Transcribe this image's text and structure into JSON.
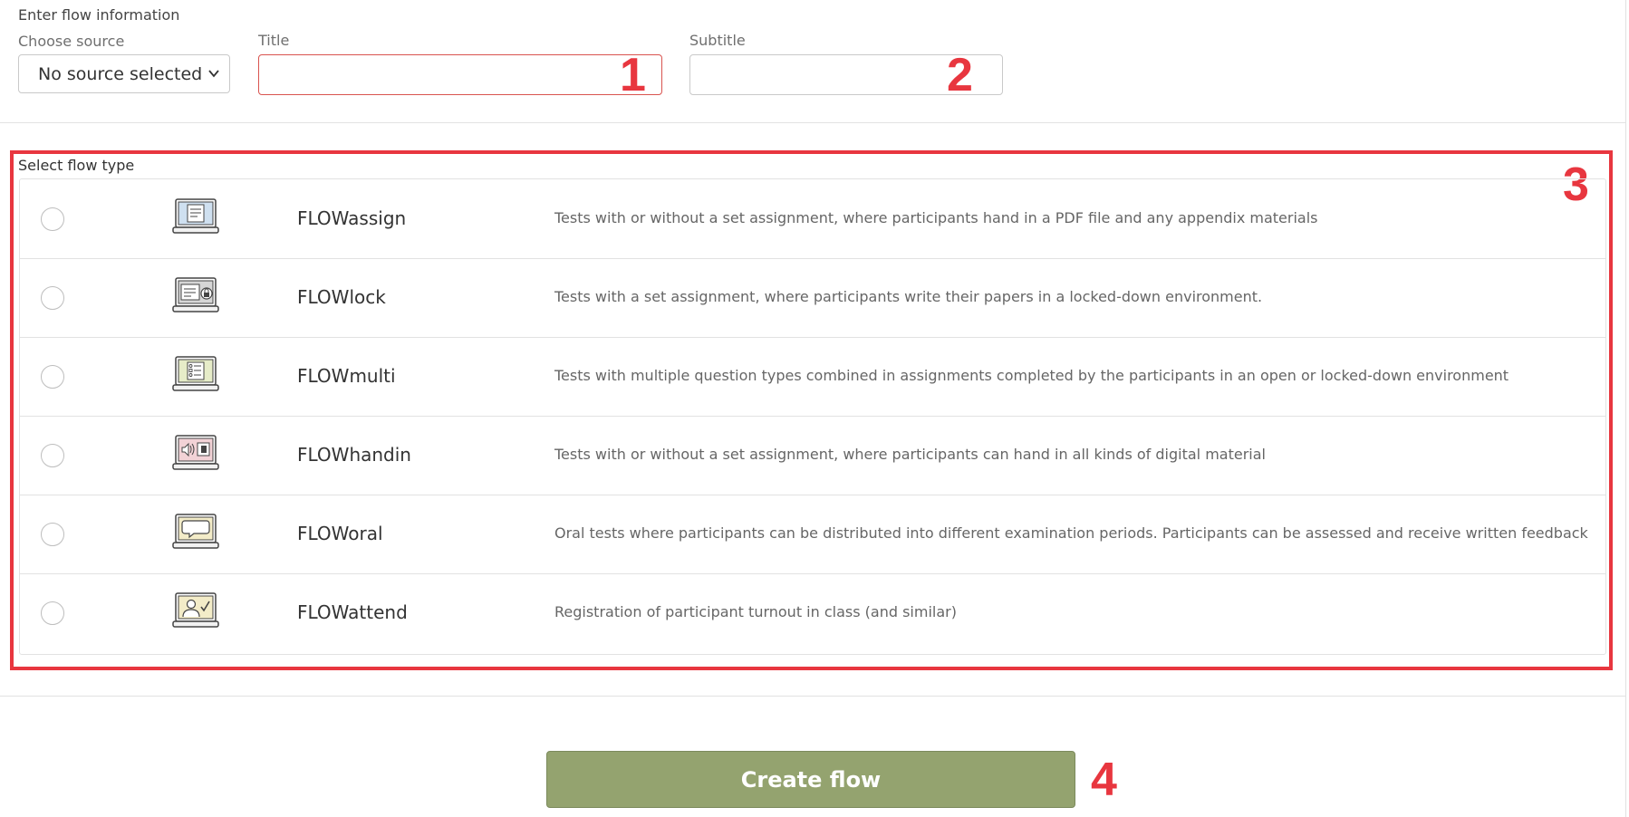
{
  "form": {
    "heading": "Enter flow information",
    "source": {
      "label": "Choose source",
      "value": "No source selected"
    },
    "title": {
      "label": "Title",
      "value": ""
    },
    "subtitle": {
      "label": "Subtitle",
      "value": ""
    }
  },
  "flow_section": {
    "label": "Select flow type",
    "items": [
      {
        "name": "FLOWassign",
        "description": "Tests with or without a set assignment, where participants hand in a PDF file and any appendix materials",
        "icon": "laptop-document-icon"
      },
      {
        "name": "FLOWlock",
        "description": "Tests with a set assignment, where participants write their papers in a locked-down environment.",
        "icon": "laptop-lock-icon"
      },
      {
        "name": "FLOWmulti",
        "description": "Tests with multiple question types combined in assignments completed by the participants in an open or locked-down environment",
        "icon": "laptop-checklist-icon"
      },
      {
        "name": "FLOWhandin",
        "description": "Tests with or without a set assignment, where participants can hand in all kinds of digital material",
        "icon": "laptop-media-icon"
      },
      {
        "name": "FLOWoral",
        "description": "Oral tests where participants can be distributed into different examination periods. Participants can be assessed and receive written feedback",
        "icon": "laptop-speech-icon"
      },
      {
        "name": "FLOWattend",
        "description": "Registration of participant turnout in class (and similar)",
        "icon": "laptop-attendance-icon"
      }
    ]
  },
  "actions": {
    "create_label": "Create flow"
  },
  "callouts": {
    "c1": "1",
    "c2": "2",
    "c3": "3",
    "c4": "4"
  },
  "colors": {
    "callout": "#e8363f",
    "button": "#94a36f",
    "invalid_border": "#d9534f"
  }
}
